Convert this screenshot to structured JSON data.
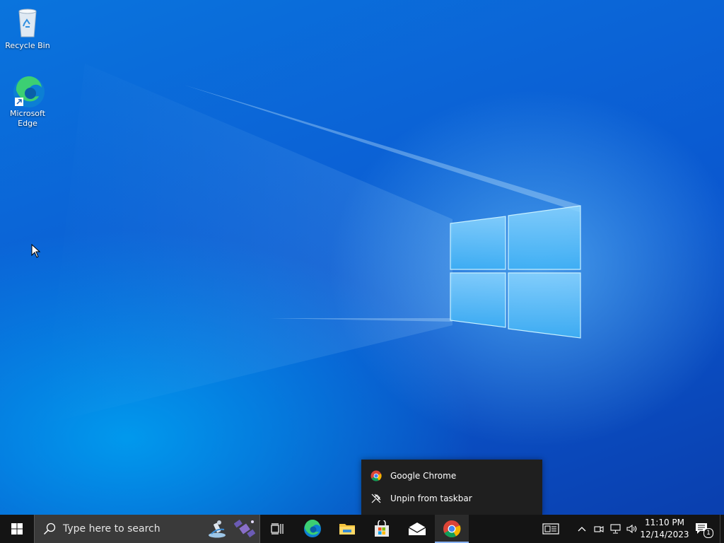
{
  "desktop": {
    "icons": [
      {
        "label": "Recycle Bin"
      },
      {
        "label": "Microsoft Edge"
      }
    ]
  },
  "context_menu": {
    "items": [
      {
        "label": "Google Chrome",
        "icon": "chrome-icon"
      },
      {
        "label": "Unpin from taskbar",
        "icon": "unpin-icon"
      }
    ]
  },
  "taskbar": {
    "search_placeholder": "Type here to search",
    "apps": [
      "task-view-icon",
      "edge-icon",
      "file-explorer-icon",
      "microsoft-store-icon",
      "mail-icon",
      "chrome-icon"
    ],
    "clock": {
      "time": "11:10 PM",
      "date": "12/14/2023"
    },
    "notification_count": "1"
  },
  "colors": {
    "taskbar": "#141414",
    "search_box": "#3a3a3a",
    "context_menu": "#1f1f1f",
    "desktop_blue": "#0a63d6"
  }
}
